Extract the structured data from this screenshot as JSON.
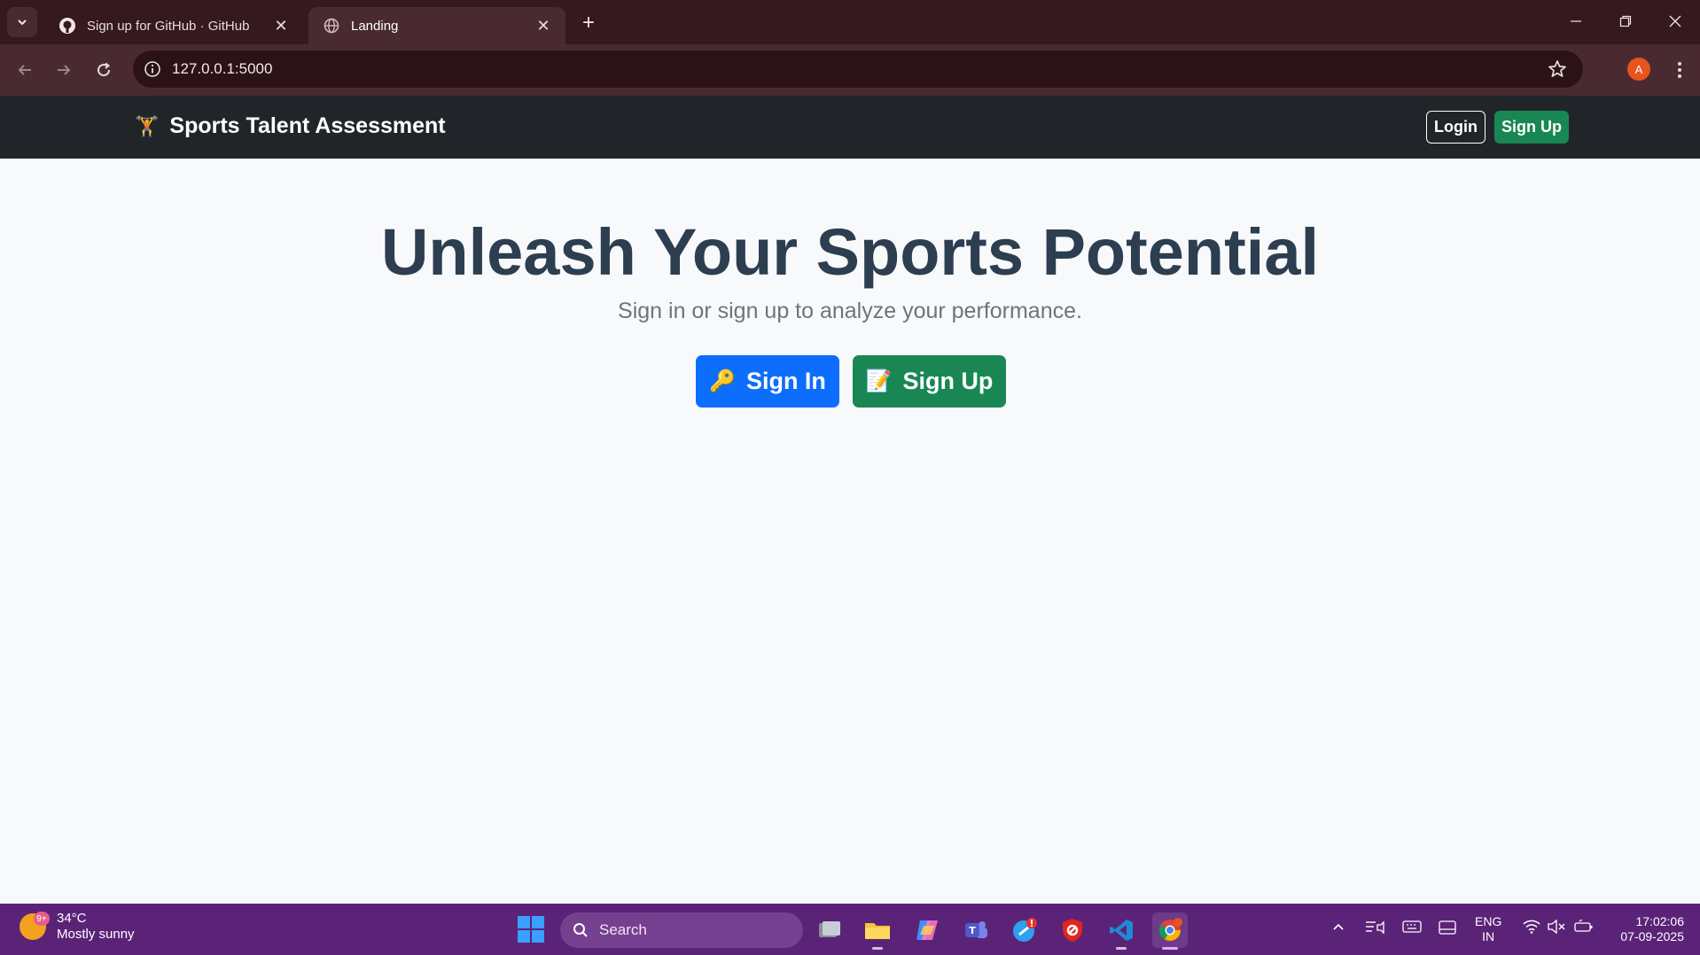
{
  "browser": {
    "tabs": [
      {
        "title": "Sign up for GitHub · GitHub",
        "active": false
      },
      {
        "title": "Landing",
        "active": true
      }
    ],
    "address": "127.0.0.1:5000",
    "profile_initial": "A"
  },
  "navbar": {
    "brand": "Sports Talent Assessment",
    "brand_icon": "🏋",
    "login_label": "Login",
    "signup_label": "Sign Up"
  },
  "hero": {
    "title": "Unleash Your Sports Potential",
    "subtitle": "Sign in or sign up to analyze your performance.",
    "signin_icon": "🔑",
    "signin_label": "Sign In",
    "signup_icon": "📝",
    "signup_label": "Sign Up"
  },
  "taskbar": {
    "weather_badge": "9+",
    "temperature": "34°C",
    "condition": "Mostly sunny",
    "search_placeholder": "Search",
    "lang_top": "ENG",
    "lang_bottom": "IN",
    "time": "17:02:06",
    "date": "07-09-2025"
  },
  "colors": {
    "primary": "#0d6efd",
    "success": "#198754",
    "navbar_bg": "#212529",
    "title_color": "#2c3e50",
    "taskbar_bg": "#5b2378"
  }
}
